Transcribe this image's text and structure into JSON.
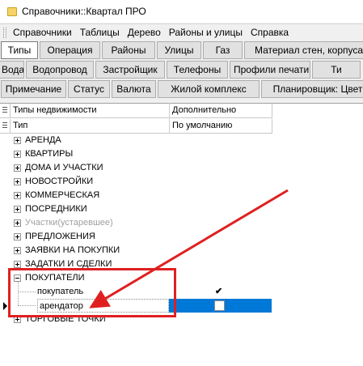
{
  "window": {
    "title": "Справочники::Квартал ПРО"
  },
  "menu": [
    "Справочники",
    "Таблицы",
    "Дерево",
    "Районы и улицы",
    "Справка"
  ],
  "button_rows": [
    [
      "Типы",
      "Операция",
      "Районы",
      "Улицы",
      "Газ",
      "Материал стен, корпуса"
    ],
    [
      "Вода",
      "Водопровод",
      "Застройщик",
      "Телефоны",
      "Профили печати",
      "Ти"
    ],
    [
      "Примечание",
      "Статус",
      "Валюта",
      "Жилой комплекс",
      "Планировщик: Цвет"
    ]
  ],
  "active_button": "Типы",
  "grid": {
    "header1": {
      "col1": "Типы недвижимости",
      "col2": "Дополнительно"
    },
    "header2": {
      "col1": "Тип",
      "col2": "По умолчанию"
    },
    "rows": [
      {
        "label": "АРЕНДА",
        "type": "group",
        "expanded": false
      },
      {
        "label": "КВАРТИРЫ",
        "type": "group",
        "expanded": false
      },
      {
        "label": "ДОМА И УЧАСТКИ",
        "type": "group",
        "expanded": false
      },
      {
        "label": "НОВОСТРОЙКИ",
        "type": "group",
        "expanded": false
      },
      {
        "label": "КОММЕРЧЕСКАЯ",
        "type": "group",
        "expanded": false
      },
      {
        "label": "ПОСРЕДНИКИ",
        "type": "group",
        "expanded": false
      },
      {
        "label": "Участки(устаревшее)",
        "type": "group",
        "expanded": false,
        "disabled": true
      },
      {
        "label": "ПРЕДЛОЖЕНИЯ",
        "type": "group",
        "expanded": false
      },
      {
        "label": "ЗАЯВКИ НА ПОКУПКИ",
        "type": "group",
        "expanded": false
      },
      {
        "label": "ЗАДАТКИ И СДЕЛКИ",
        "type": "group",
        "expanded": false
      },
      {
        "label": "ПОКУПАТЕЛИ",
        "type": "group",
        "expanded": true
      },
      {
        "label": "покупатель",
        "type": "child",
        "default_checked": true
      },
      {
        "label": "арендатор",
        "type": "child",
        "default_checked": false,
        "selected": true
      },
      {
        "label": "ТОРГОВЫЕ ТОЧКИ",
        "type": "group",
        "expanded": false
      }
    ]
  },
  "colors": {
    "selection": "#0078d7",
    "annotation": "#e02020",
    "disabled_text": "#a0a0a0"
  }
}
